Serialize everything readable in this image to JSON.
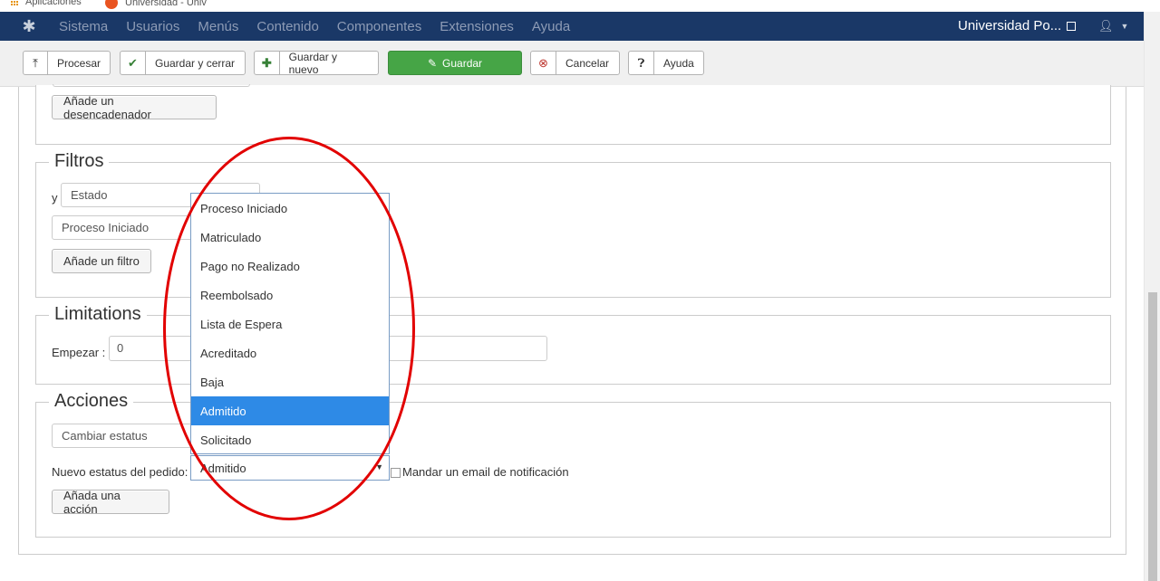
{
  "bookmarks": {
    "apps_label": "Aplicaciones",
    "univ_label": "Universidad - Univ"
  },
  "navbar": {
    "menu": [
      "Sistema",
      "Usuarios",
      "Menús",
      "Contenido",
      "Componentes",
      "Extensiones",
      "Ayuda"
    ],
    "site_name": "Universidad Po..."
  },
  "toolbar": {
    "process_label": "Procesar",
    "save_close_label": "Guardar y cerrar",
    "save_new_label": "Guardar y nuevo",
    "save_label": "Guardar",
    "cancel_label": "Cancelar",
    "help_label": "Ayuda"
  },
  "triggers": {
    "add_trigger_label": "Añade un desencadenador"
  },
  "filters": {
    "legend": "Filtros",
    "conjunction": "y",
    "field_value": "Estado",
    "value_selected": "Proceso Iniciado",
    "add_filter_label": "Añade un filtro"
  },
  "limitations": {
    "legend": "Limitations",
    "start_label": "Empezar :",
    "start_value": "0"
  },
  "actions": {
    "legend": "Acciones",
    "action_value": "Cambiar estatus",
    "new_status_label": "Nuevo estatus del pedido:",
    "new_status_value": "Admitido",
    "notify_label": "Mandar un email de notificación",
    "add_action_label": "Añada una acción"
  },
  "dropdown": {
    "options": [
      "Proceso Iniciado",
      "Matriculado",
      "Pago no Realizado",
      "Reembolsado",
      "Lista de Espera",
      "Acreditado",
      "Baja",
      "Admitido",
      "Solicitado"
    ],
    "highlighted": "Admitido"
  },
  "colors": {
    "navbar": "#1a3867",
    "save_button": "#46a546",
    "highlight": "#2e8ae6",
    "annotation": "#e20000"
  },
  "icons": {
    "process": "upload-icon",
    "save_close": "check-icon",
    "save_new": "plus-icon",
    "save": "edit-icon",
    "cancel": "cancel-circle-icon",
    "help": "question-circle-icon"
  }
}
